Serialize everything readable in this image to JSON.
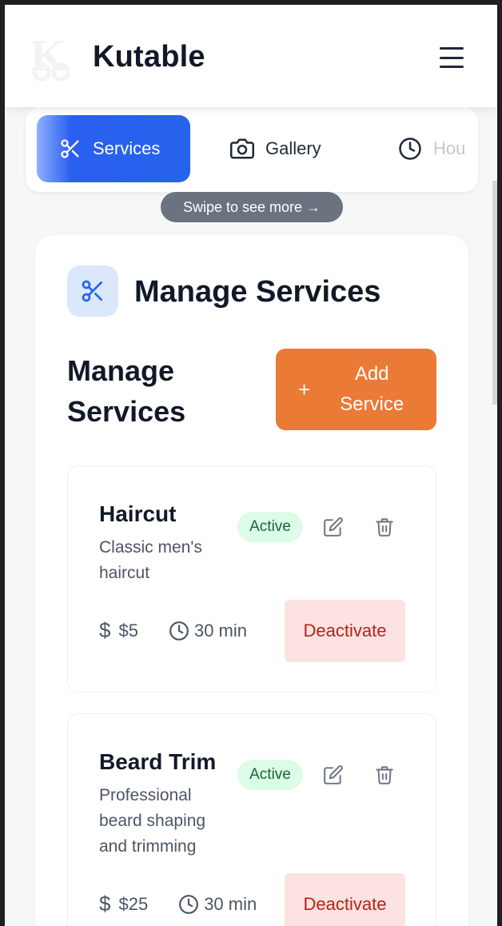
{
  "header": {
    "title": "Kutable",
    "logo_letter": "K"
  },
  "tabs": [
    {
      "label": "Services",
      "icon": "scissors-icon",
      "active": true
    },
    {
      "label": "Gallery",
      "icon": "camera-icon",
      "active": false
    },
    {
      "label": "Hou",
      "icon": "clock-icon",
      "active": false
    }
  ],
  "swipe_hint": "Swipe to see more →",
  "section": {
    "title": "Manage Services",
    "subtitle": "Manage Services",
    "add_button": {
      "icon": "+",
      "label": "Add Service"
    }
  },
  "services": [
    {
      "name": "Haircut",
      "description": "Classic men's haircut",
      "status": "Active",
      "price": "$5",
      "duration": "30 min",
      "action": "Deactivate"
    },
    {
      "name": "Beard Trim",
      "description": "Professional beard shaping and trimming",
      "status": "Active",
      "price": "$25",
      "duration": "30 min",
      "action": "Deactivate"
    }
  ],
  "colors": {
    "primary": "#2563eb",
    "accent": "#ea7a35",
    "active_badge_bg": "#dcfce7",
    "active_badge_text": "#166534",
    "danger_bg": "#fde2e2",
    "danger_text": "#b42318"
  }
}
